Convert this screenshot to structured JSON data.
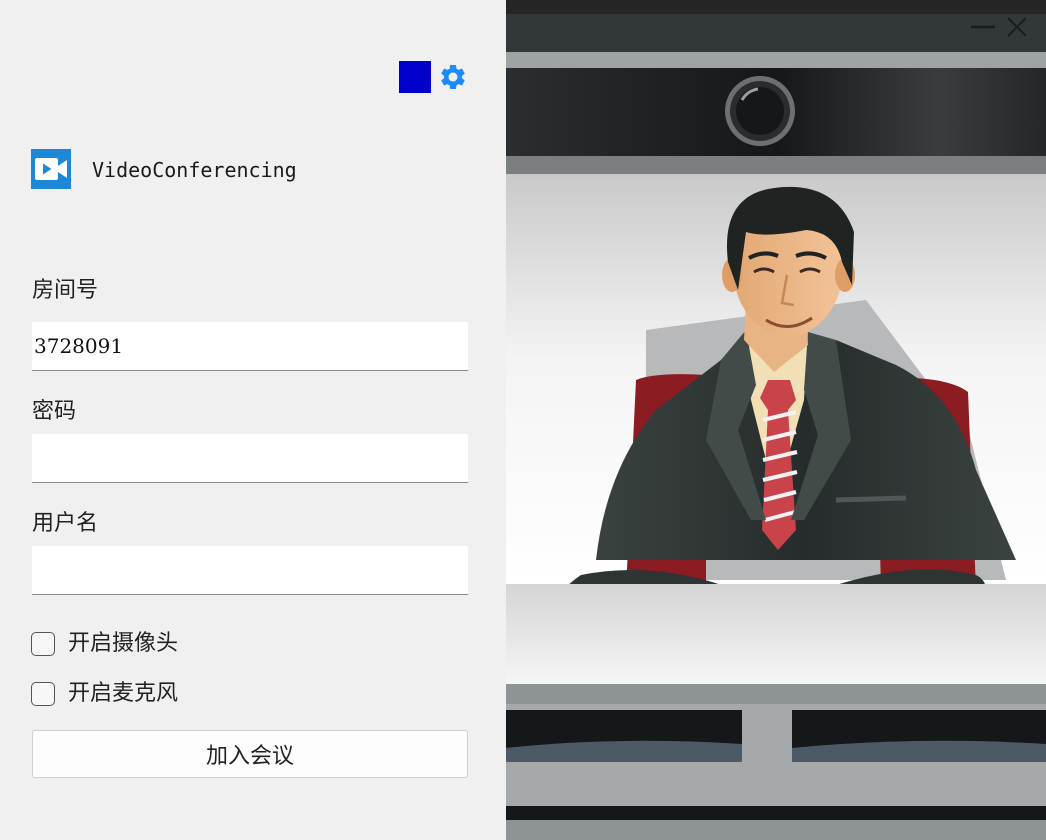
{
  "app": {
    "name": "VideoConferencing",
    "logo_icon": "video-camera-icon",
    "settings_icon": "gear-icon",
    "accent_color": "#0000cc",
    "settings_color": "#1a8cff"
  },
  "window_controls": {
    "minimize_icon": "minimize-icon",
    "close_icon": "close-icon"
  },
  "form": {
    "room": {
      "label": "房间号",
      "value": "3728091",
      "placeholder": ""
    },
    "password": {
      "label": "密码",
      "value": "",
      "placeholder": ""
    },
    "username": {
      "label": "用户名",
      "value": "",
      "placeholder": ""
    },
    "camera": {
      "label": "开启摄像头",
      "checked": false
    },
    "microphone": {
      "label": "开启麦克风",
      "checked": false
    },
    "join_label": "加入会议"
  },
  "illustration": {
    "subject": "businessman-at-desk-illustration"
  }
}
